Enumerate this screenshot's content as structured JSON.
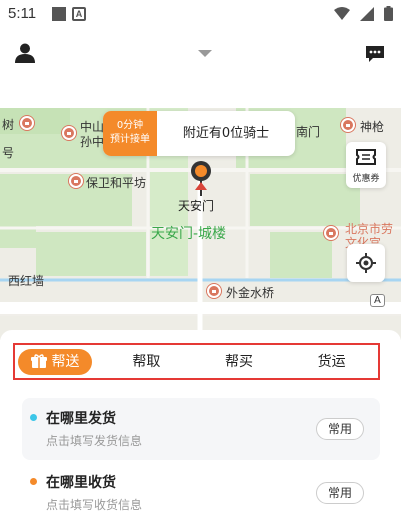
{
  "status_bar": {
    "time": "5:11",
    "icons": [
      "square-icon",
      "a-icon",
      "wifi-icon",
      "signal-icon",
      "battery-icon"
    ]
  },
  "header": {
    "icons": [
      "user-icon",
      "dropdown-arrow-icon",
      "message-icon"
    ]
  },
  "map": {
    "labels": {
      "zhongshan": "中山",
      "sunzhong": "孙中",
      "baowei": "保卫和平坊",
      "tiananmen_pin": "天安门",
      "tiananmen_gate": "天安门-城楼",
      "xihongqiang": "西红墙",
      "waijinshui": "外金水桥",
      "shenwu": "神枪",
      "nanmen": "南门",
      "beijing": "北京市劳",
      "wenhua": "文化宫",
      "road_a": "A",
      "edge_left": "树",
      "edge_left2": "号"
    },
    "bubble": {
      "minutes": "0分钟",
      "eta": "预计接单",
      "nearby": "附近有0位骑士"
    },
    "coupon_label": "优惠券"
  },
  "colors": {
    "accent": "#f48a2a",
    "highlight_border": "#e53935",
    "park_green": "#cfe7c1",
    "send_dot": "#3cc6e8",
    "receive_dot": "#f48a2a"
  },
  "tabs": [
    {
      "label": "帮送",
      "active": true
    },
    {
      "label": "帮取",
      "active": false
    },
    {
      "label": "帮买",
      "active": false
    },
    {
      "label": "货运",
      "active": false
    }
  ],
  "addresses": [
    {
      "title": "在哪里发货",
      "subtitle": "点击填写发货信息",
      "button": "常用"
    },
    {
      "title": "在哪里收货",
      "subtitle": "点击填写收货信息",
      "button": "常用"
    }
  ]
}
